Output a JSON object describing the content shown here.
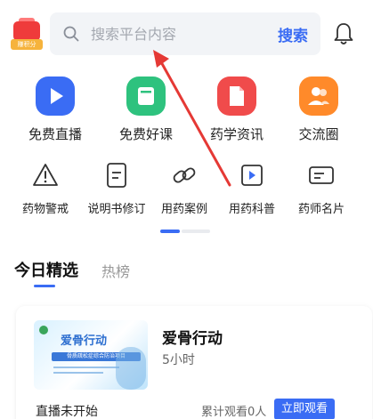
{
  "header": {
    "wallet_badge": "赚积分",
    "search_placeholder": "搜索平台内容",
    "search_button": "搜索"
  },
  "main_menu": [
    {
      "label": "免费直播",
      "icon": "play-icon",
      "color": "#3a6cf4"
    },
    {
      "label": "免费好课",
      "icon": "book-icon",
      "color": "#2ec27e"
    },
    {
      "label": "药学资讯",
      "icon": "document-icon",
      "color": "#f04b4b"
    },
    {
      "label": "交流圈",
      "icon": "people-icon",
      "color": "#ff8a2a"
    }
  ],
  "sub_menu": [
    {
      "label": "药物警戒",
      "icon": "warning-icon"
    },
    {
      "label": "说明书修订",
      "icon": "manual-icon"
    },
    {
      "label": "用药案例",
      "icon": "link-icon"
    },
    {
      "label": "用药科普",
      "icon": "video-icon"
    },
    {
      "label": "药师名片",
      "icon": "card-icon"
    }
  ],
  "tabs": [
    {
      "label": "今日精选",
      "active": true
    },
    {
      "label": "热榜",
      "active": false
    }
  ],
  "card": {
    "thumbnail_title": "爱骨行动",
    "thumbnail_subtitle": "骨质疏松症综合防治项目",
    "title": "爱骨行动",
    "duration": "5小时",
    "status": "直播未开始",
    "views": "累计观看0人",
    "button": "立即观看"
  },
  "colors": {
    "accent": "#3a6cf4",
    "annotation_arrow": "#e53935"
  }
}
